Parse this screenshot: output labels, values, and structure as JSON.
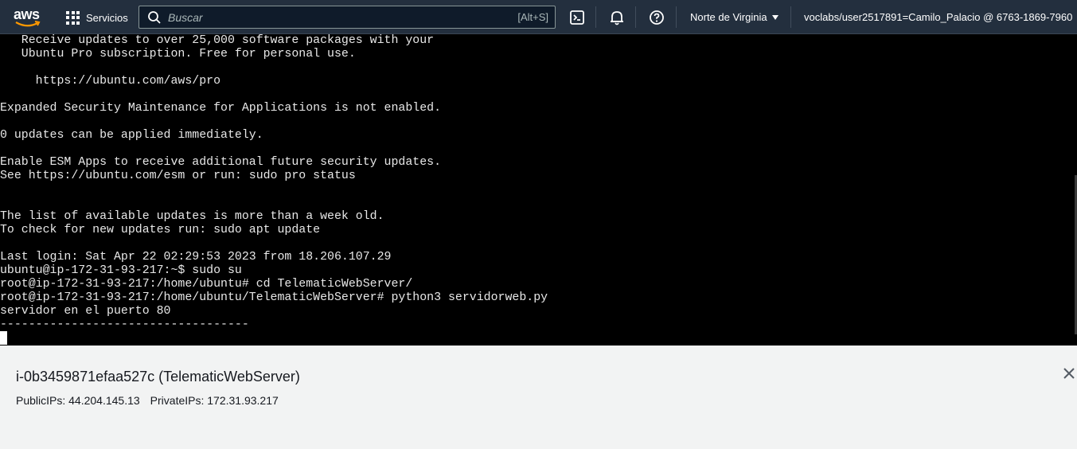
{
  "nav": {
    "logo_text": "aws",
    "services_label": "Servicios",
    "search_placeholder": "Buscar",
    "search_shortcut": "[Alt+S]",
    "region_label": "Norte de Virginia",
    "account_label": "voclabs/user2517891=Camilo_Palacio @ 6763-1869-7960",
    "icons": [
      "aws-logo",
      "grid-icon",
      "search-icon",
      "cloudshell-icon",
      "bell-icon",
      "help-icon"
    ]
  },
  "terminal": {
    "lines": [
      "   Receive updates to over 25,000 software packages with your",
      "   Ubuntu Pro subscription. Free for personal use.",
      "",
      "     https://ubuntu.com/aws/pro",
      "",
      "Expanded Security Maintenance for Applications is not enabled.",
      "",
      "0 updates can be applied immediately.",
      "",
      "Enable ESM Apps to receive additional future security updates.",
      "See https://ubuntu.com/esm or run: sudo pro status",
      "",
      "",
      "The list of available updates is more than a week old.",
      "To check for new updates run: sudo apt update",
      "",
      "Last login: Sat Apr 22 02:29:53 2023 from 18.206.107.29",
      "ubuntu@ip-172-31-93-217:~$ sudo su",
      "root@ip-172-31-93-217:/home/ubuntu# cd TelematicWebServer/",
      "root@ip-172-31-93-217:/home/ubuntu/TelematicWebServer# python3 servidorweb.py",
      "servidor en el puerto 80",
      "-----------------------------------"
    ]
  },
  "instance": {
    "title": "i-0b3459871efaa527c (TelematicWebServer)",
    "public_ips": "PublicIPs: 44.204.145.13",
    "private_ips": "PrivateIPs: 172.31.93.217"
  },
  "colors": {
    "nav_bg": "#232f3e",
    "terminal_bg": "#000000",
    "terminal_fg": "#e8e8e8",
    "panel_bg": "#f2f3f3"
  }
}
